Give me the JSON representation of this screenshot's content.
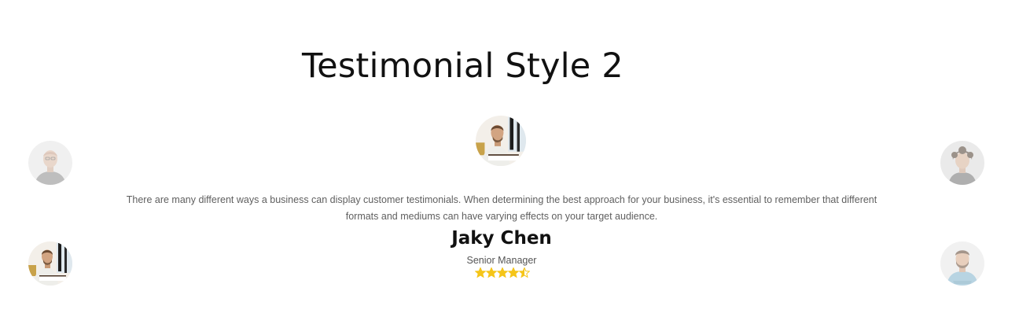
{
  "section": {
    "title": "Testimonial Style 2"
  },
  "testimonial": {
    "quote": "There are many different ways a business can display customer testimonials. When determining the best approach for your business, it's essential to remember that different formats and mediums can have varying effects on your target audience.",
    "name": "Jaky Chen",
    "role": "Senior Manager",
    "rating": 4.5,
    "rating_max": 5,
    "star_color": "#f5c518"
  },
  "avatars": [
    {
      "id": "left-top",
      "icon": "bald-man-avatar"
    },
    {
      "id": "left-bottom",
      "icon": "man-at-desk-avatar"
    },
    {
      "id": "center",
      "icon": "man-at-desk-avatar"
    },
    {
      "id": "right-top",
      "icon": "curly-hair-avatar"
    },
    {
      "id": "right-bottom",
      "icon": "bearded-man-avatar"
    }
  ]
}
